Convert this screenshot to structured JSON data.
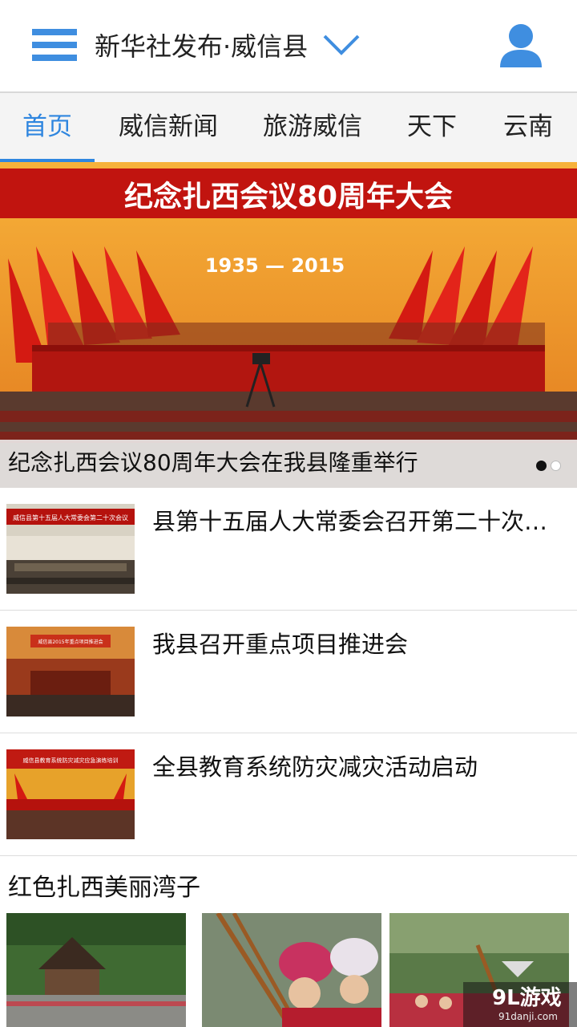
{
  "header": {
    "title": "新华社发布·威信县",
    "menu_icon": "hamburger-menu-icon",
    "dropdown_icon": "chevron-down-icon",
    "user_icon": "user-profile-icon",
    "accent_color": "#3f8ee0"
  },
  "tabs": [
    {
      "label": "首页",
      "active": true
    },
    {
      "label": "威信新闻",
      "active": false
    },
    {
      "label": "旅游威信",
      "active": false
    },
    {
      "label": "天下",
      "active": false
    },
    {
      "label": "云南",
      "active": false
    }
  ],
  "hero": {
    "banner_text": "纪念扎西会议80周年大会",
    "banner_years": "1935 — 2015",
    "caption": "纪念扎西会议80周年大会在我县隆重举行",
    "slide_count": 2,
    "active_slide": 1
  },
  "news": [
    {
      "title": "县第十五届人大常委会召开第二十次会议",
      "thumb_banner": "威信县第十五届人大常委会第二十次会议"
    },
    {
      "title": "我县召开重点项目推进会",
      "thumb_banner": "威信县2015年重点项目推进会"
    },
    {
      "title": "全县教育系统防灾减灾活动启动",
      "thumb_banner": "威信县教育系统防灾减灾应急演练培训"
    }
  ],
  "section": {
    "title": "红色扎西美丽湾子"
  },
  "watermark": {
    "main": "9L游戏",
    "sub": "91danji.com"
  }
}
